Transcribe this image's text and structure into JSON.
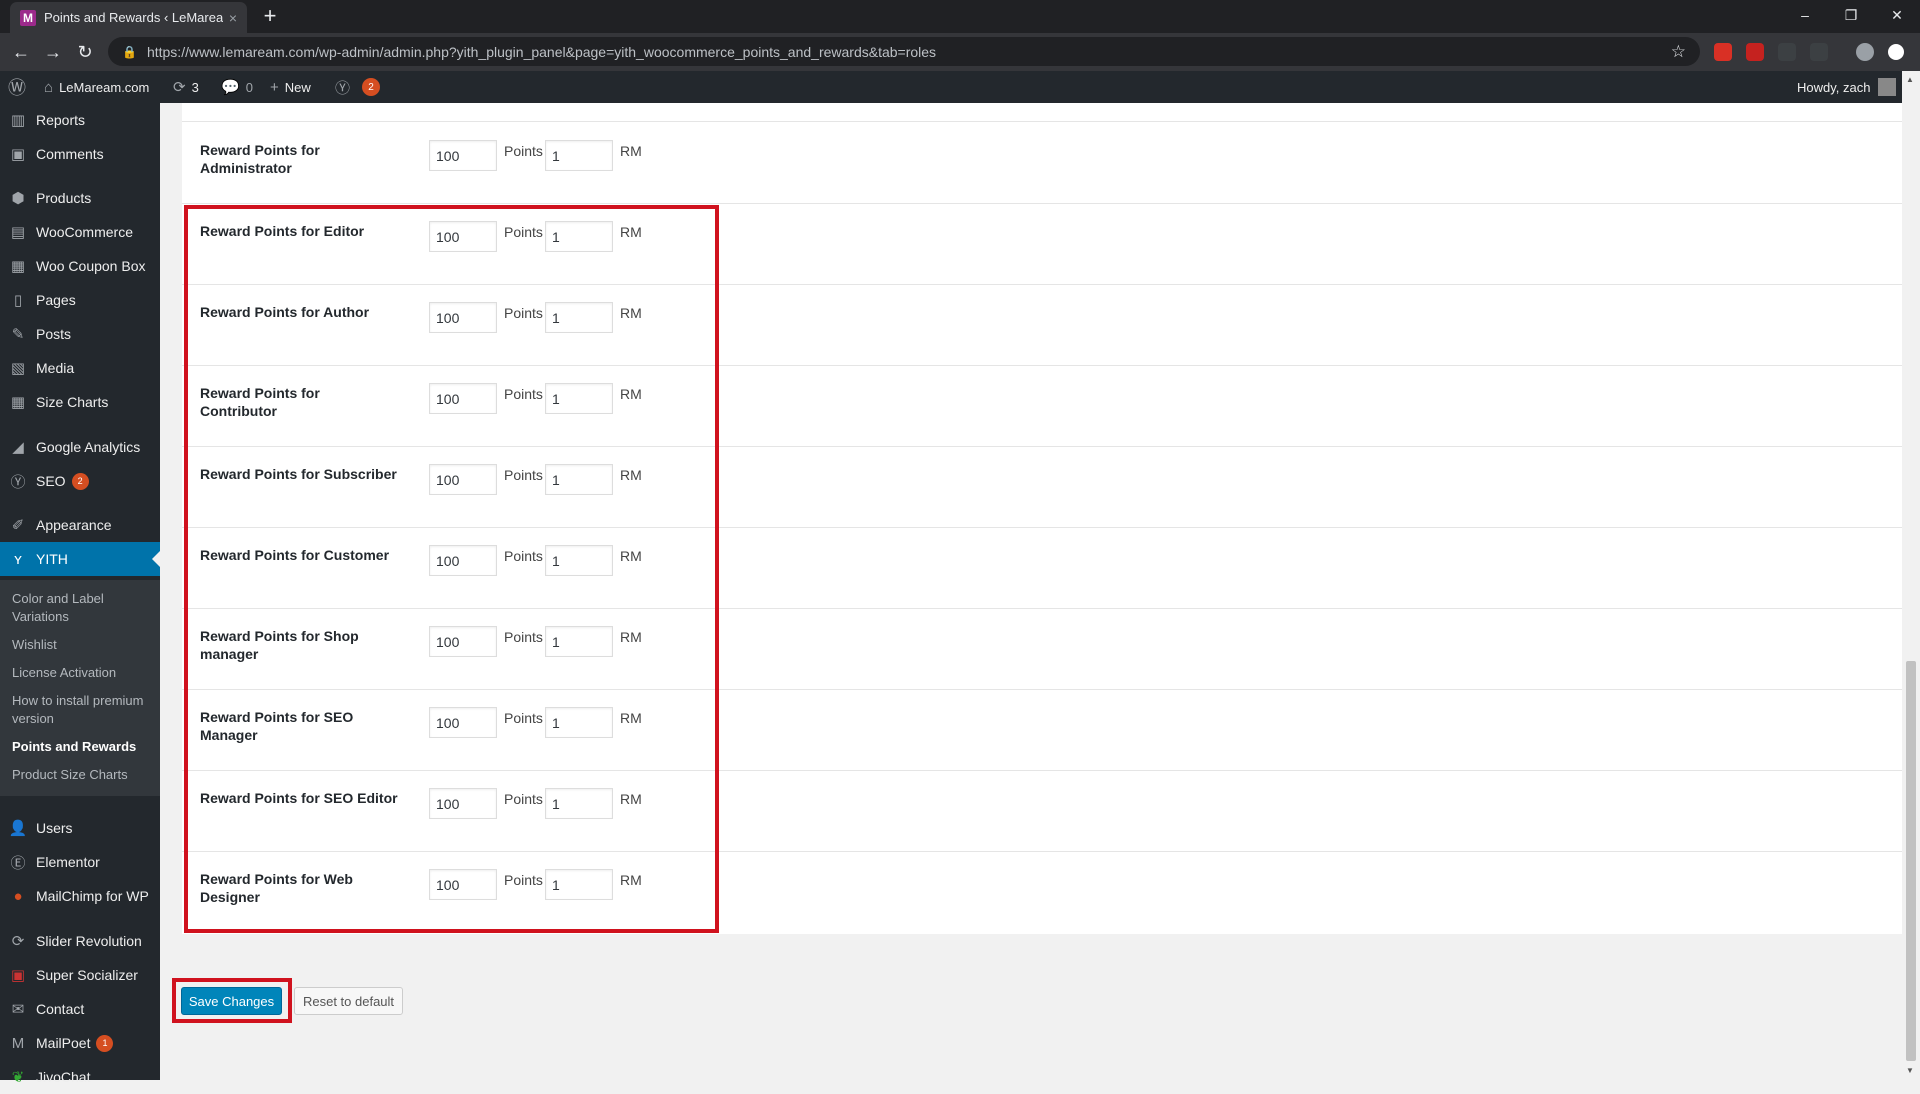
{
  "browser": {
    "tab_title": "Points and Rewards ‹ LeMaream.",
    "tab_favicon": "M",
    "tab_close": "×",
    "new_tab": "+",
    "url": "https://www.lemaream.com/wp-admin/admin.php?yith_plugin_panel&page=yith_woocommerce_points_and_rewards&tab=roles",
    "window_minimize": "–",
    "window_restore": "❐",
    "window_close": "✕"
  },
  "adminbar": {
    "site_name": "LeMaream.com",
    "updates_count": "3",
    "comments_count": "0",
    "new_label": "New",
    "yoast_badge": "2",
    "howdy": "Howdy, zach"
  },
  "sidebar": {
    "items": [
      {
        "label": "Reports",
        "icon": "reports-icon"
      },
      {
        "label": "Comments",
        "icon": "comments-icon"
      },
      {
        "label": "Products",
        "icon": "products-icon"
      },
      {
        "label": "WooCommerce",
        "icon": "woocommerce-icon"
      },
      {
        "label": "Woo Coupon Box",
        "icon": "coupon-icon"
      },
      {
        "label": "Pages",
        "icon": "pages-icon"
      },
      {
        "label": "Posts",
        "icon": "posts-icon"
      },
      {
        "label": "Media",
        "icon": "media-icon"
      },
      {
        "label": "Size Charts",
        "icon": "size-charts-icon"
      },
      {
        "label": "Google Analytics",
        "icon": "analytics-icon"
      },
      {
        "label": "SEO",
        "icon": "seo-icon",
        "badge": "2"
      },
      {
        "label": "Appearance",
        "icon": "appearance-icon"
      },
      {
        "label": "YITH",
        "icon": "yith-icon"
      },
      {
        "label": "Users",
        "icon": "users-icon"
      },
      {
        "label": "Elementor",
        "icon": "elementor-icon"
      },
      {
        "label": "MailChimp for WP",
        "icon": "mailchimp-icon"
      },
      {
        "label": "Slider Revolution",
        "icon": "slider-icon"
      },
      {
        "label": "Super Socializer",
        "icon": "socializer-icon"
      },
      {
        "label": "Contact",
        "icon": "contact-icon"
      },
      {
        "label": "MailPoet",
        "icon": "mailpoet-icon",
        "badge": "1"
      },
      {
        "label": "JivoChat",
        "icon": "jivochat-icon"
      }
    ],
    "yith_submenu": [
      "Color and Label Variations",
      "Wishlist",
      "License Activation",
      "How to install premium version",
      "Points and Rewards",
      "Product Size Charts"
    ]
  },
  "form": {
    "points_unit": "Points",
    "currency_unit": "RM",
    "rows": [
      {
        "label": "Reward Points for Administrator",
        "points": "100",
        "amount": "1"
      },
      {
        "label": "Reward Points for Editor",
        "points": "100",
        "amount": "1"
      },
      {
        "label": "Reward Points for Author",
        "points": "100",
        "amount": "1"
      },
      {
        "label": "Reward Points for Contributor",
        "points": "100",
        "amount": "1"
      },
      {
        "label": "Reward Points for Subscriber",
        "points": "100",
        "amount": "1"
      },
      {
        "label": "Reward Points for Customer",
        "points": "100",
        "amount": "1"
      },
      {
        "label": "Reward Points for Shop manager",
        "points": "100",
        "amount": "1"
      },
      {
        "label": "Reward Points for SEO Manager",
        "points": "100",
        "amount": "1"
      },
      {
        "label": "Reward Points for SEO Editor",
        "points": "100",
        "amount": "1"
      },
      {
        "label": "Reward Points for Web Designer",
        "points": "100",
        "amount": "1"
      }
    ],
    "save_label": "Save Changes",
    "reset_label": "Reset to default"
  },
  "colors": {
    "highlight": "#d0121e",
    "wp_blue": "#0073aa",
    "admin_dark": "#23282d"
  }
}
